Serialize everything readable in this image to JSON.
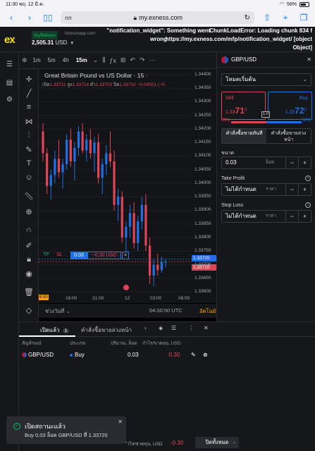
{
  "status_bar": {
    "time": "11:30",
    "date": "พฤ. 12 มี.ค.",
    "battery": "58%"
  },
  "browser": {
    "aa": "กก",
    "url": "my.exness.com",
    "lock_icon": "lock-icon"
  },
  "header": {
    "logo": "ex",
    "account_type": "บัญชีทดลอง",
    "server": "forexonapp.com",
    "balance": "2,505.31",
    "currency": "USD",
    "error_left": "\"notification_widget\": Something went wrong",
    "error_right": "ChunkLoadError: Loading chunk 834 f https://my.exness.com/mfp/notification_widget/ [object Object]"
  },
  "chart_toolbar": {
    "timeframes": [
      "1m",
      "5m",
      "4h",
      "15m"
    ],
    "active_timeframe": "15m"
  },
  "chart": {
    "title": "Great Britain Pound vs US Dollar · 15 ·",
    "open_label": "เปิด",
    "open": "1.33711",
    "high_label": "สูง",
    "high": "1.33714",
    "low_label": "ต่ำ",
    "low": "1.33702",
    "close_label": "ปิด",
    "close": "1.33710",
    "change": "−0.00001 (−0.",
    "ask_tag": "1.33720",
    "bid_tag": "1.33710",
    "x_left_tag": "6:00",
    "footer_range": "ช่วงวันที่",
    "footer_clock": "04:30:50 UTC",
    "footer_auto": "อัตโนมัติ"
  },
  "position_line": {
    "tp": "TP",
    "sl": "SL",
    "volume": "0.03",
    "pnl": "−0.30 USD",
    "close": "×"
  },
  "chart_data": {
    "type": "candlestick",
    "y_ticks": [
      "1.34400",
      "1.34350",
      "1.34300",
      "1.34250",
      "1.34200",
      "1.34150",
      "1.34100",
      "1.34050",
      "1.34000",
      "1.33950",
      "1.33900",
      "1.33850",
      "1.33800",
      "1.33750",
      "1.33700",
      "1.33650",
      "1.33600"
    ],
    "x_ticks": [
      "18:00",
      "21:00",
      "12",
      "03:00",
      "06:00"
    ],
    "ylim": [
      1.3359,
      1.3442
    ],
    "candles": [
      {
        "o": 1.3419,
        "h": 1.3422,
        "l": 1.3408,
        "c": 1.3411
      },
      {
        "o": 1.3411,
        "h": 1.3413,
        "l": 1.3396,
        "c": 1.3399
      },
      {
        "o": 1.3399,
        "h": 1.3405,
        "l": 1.3394,
        "c": 1.3403
      },
      {
        "o": 1.3403,
        "h": 1.3412,
        "l": 1.34,
        "c": 1.3409
      },
      {
        "o": 1.3409,
        "h": 1.3416,
        "l": 1.3402,
        "c": 1.3404
      },
      {
        "o": 1.3404,
        "h": 1.3409,
        "l": 1.3398,
        "c": 1.3407
      },
      {
        "o": 1.3407,
        "h": 1.3418,
        "l": 1.3405,
        "c": 1.3416
      },
      {
        "o": 1.3416,
        "h": 1.342,
        "l": 1.3406,
        "c": 1.3408
      },
      {
        "o": 1.3408,
        "h": 1.3415,
        "l": 1.3401,
        "c": 1.3413
      },
      {
        "o": 1.3413,
        "h": 1.3421,
        "l": 1.341,
        "c": 1.3419
      },
      {
        "o": 1.3419,
        "h": 1.3422,
        "l": 1.3411,
        "c": 1.3412
      },
      {
        "o": 1.3412,
        "h": 1.3418,
        "l": 1.3408,
        "c": 1.3416
      },
      {
        "o": 1.3416,
        "h": 1.342,
        "l": 1.3409,
        "c": 1.3411
      },
      {
        "o": 1.3411,
        "h": 1.3417,
        "l": 1.3404,
        "c": 1.3415
      },
      {
        "o": 1.3415,
        "h": 1.3418,
        "l": 1.34,
        "c": 1.3402
      },
      {
        "o": 1.3402,
        "h": 1.3409,
        "l": 1.3396,
        "c": 1.3407
      },
      {
        "o": 1.3407,
        "h": 1.3414,
        "l": 1.3403,
        "c": 1.3411
      },
      {
        "o": 1.3411,
        "h": 1.3419,
        "l": 1.3406,
        "c": 1.3408
      },
      {
        "o": 1.3408,
        "h": 1.3412,
        "l": 1.339,
        "c": 1.3392
      },
      {
        "o": 1.3392,
        "h": 1.3398,
        "l": 1.3386,
        "c": 1.3395
      },
      {
        "o": 1.3395,
        "h": 1.3397,
        "l": 1.3378,
        "c": 1.338
      },
      {
        "o": 1.338,
        "h": 1.3386,
        "l": 1.3372,
        "c": 1.3384
      },
      {
        "o": 1.3384,
        "h": 1.3392,
        "l": 1.338,
        "c": 1.3389
      },
      {
        "o": 1.3389,
        "h": 1.3393,
        "l": 1.3376,
        "c": 1.3378
      },
      {
        "o": 1.3378,
        "h": 1.3388,
        "l": 1.3375,
        "c": 1.3386
      },
      {
        "o": 1.3386,
        "h": 1.3395,
        "l": 1.3383,
        "c": 1.3392
      },
      {
        "o": 1.3392,
        "h": 1.3396,
        "l": 1.3375,
        "c": 1.3377
      },
      {
        "o": 1.3377,
        "h": 1.338,
        "l": 1.3363,
        "c": 1.3366
      },
      {
        "o": 1.3366,
        "h": 1.3372,
        "l": 1.3362,
        "c": 1.337
      },
      {
        "o": 1.337,
        "h": 1.3374,
        "l": 1.3366,
        "c": 1.3368
      },
      {
        "o": 1.3368,
        "h": 1.3373,
        "l": 1.3367,
        "c": 1.3371
      },
      {
        "o": 1.3371,
        "h": 1.3372,
        "l": 1.3369,
        "c": 1.3371
      }
    ]
  },
  "right_panel": {
    "symbol": "GBP/USD",
    "mode": "โหมดเริ่มต้น",
    "sell_label": "Sell",
    "buy_label": "Buy",
    "sell_price_small": "1.33",
    "sell_price_big": "71",
    "sell_price_sup": "0",
    "buy_price_small": "1.33",
    "buy_price_big": "72",
    "buy_price_sup": "0",
    "spread": "1.0",
    "sentiment_sell": "50%",
    "sentiment_buy": "50%",
    "tab_market": "คำสั่งซื้อขายทันที",
    "tab_pending": "คำสั่งซื้อขายล่วงหน้า",
    "volume_label": "ขนาด",
    "volume_value": "0.03",
    "volume_unit": "ล็อต",
    "tp_label": "Take Profit",
    "tp_value": "ไม่ได้กำหนด",
    "tp_mode": "ราคา",
    "sl_label": "Stop Loss",
    "sl_value": "ไม่ได้กำหนด",
    "sl_mode": "ราคา"
  },
  "bottom_panel": {
    "tab_open": "เปิดแล้ว",
    "tab_open_count": "1",
    "tab_pending": "คำสั่งซื้อขายล่วงหน้า",
    "columns": [
      "สัญลักษณ์",
      "ประเภท",
      "ปริมาณ, ล็อต",
      "กำไร/ขาดทุน, USD"
    ],
    "rows": [
      {
        "symbol": "GBP/USD",
        "type": "Buy",
        "volume": "0.03",
        "pnl": "-0.30"
      }
    ]
  },
  "toast": {
    "title": "เปิดสถานะแล้ว",
    "message": "Buy 0.03 ล็อต GBP/USD ที่ 1.33720"
  },
  "footer": {
    "pnl_label": "ำไร/ขาดทุน, USD",
    "pnl_value": "-0.30",
    "close_all": "ปิดทั้งหมด"
  },
  "colors": {
    "up": "#1f6fe6",
    "down": "#e04556",
    "accent": "#ffde02"
  }
}
